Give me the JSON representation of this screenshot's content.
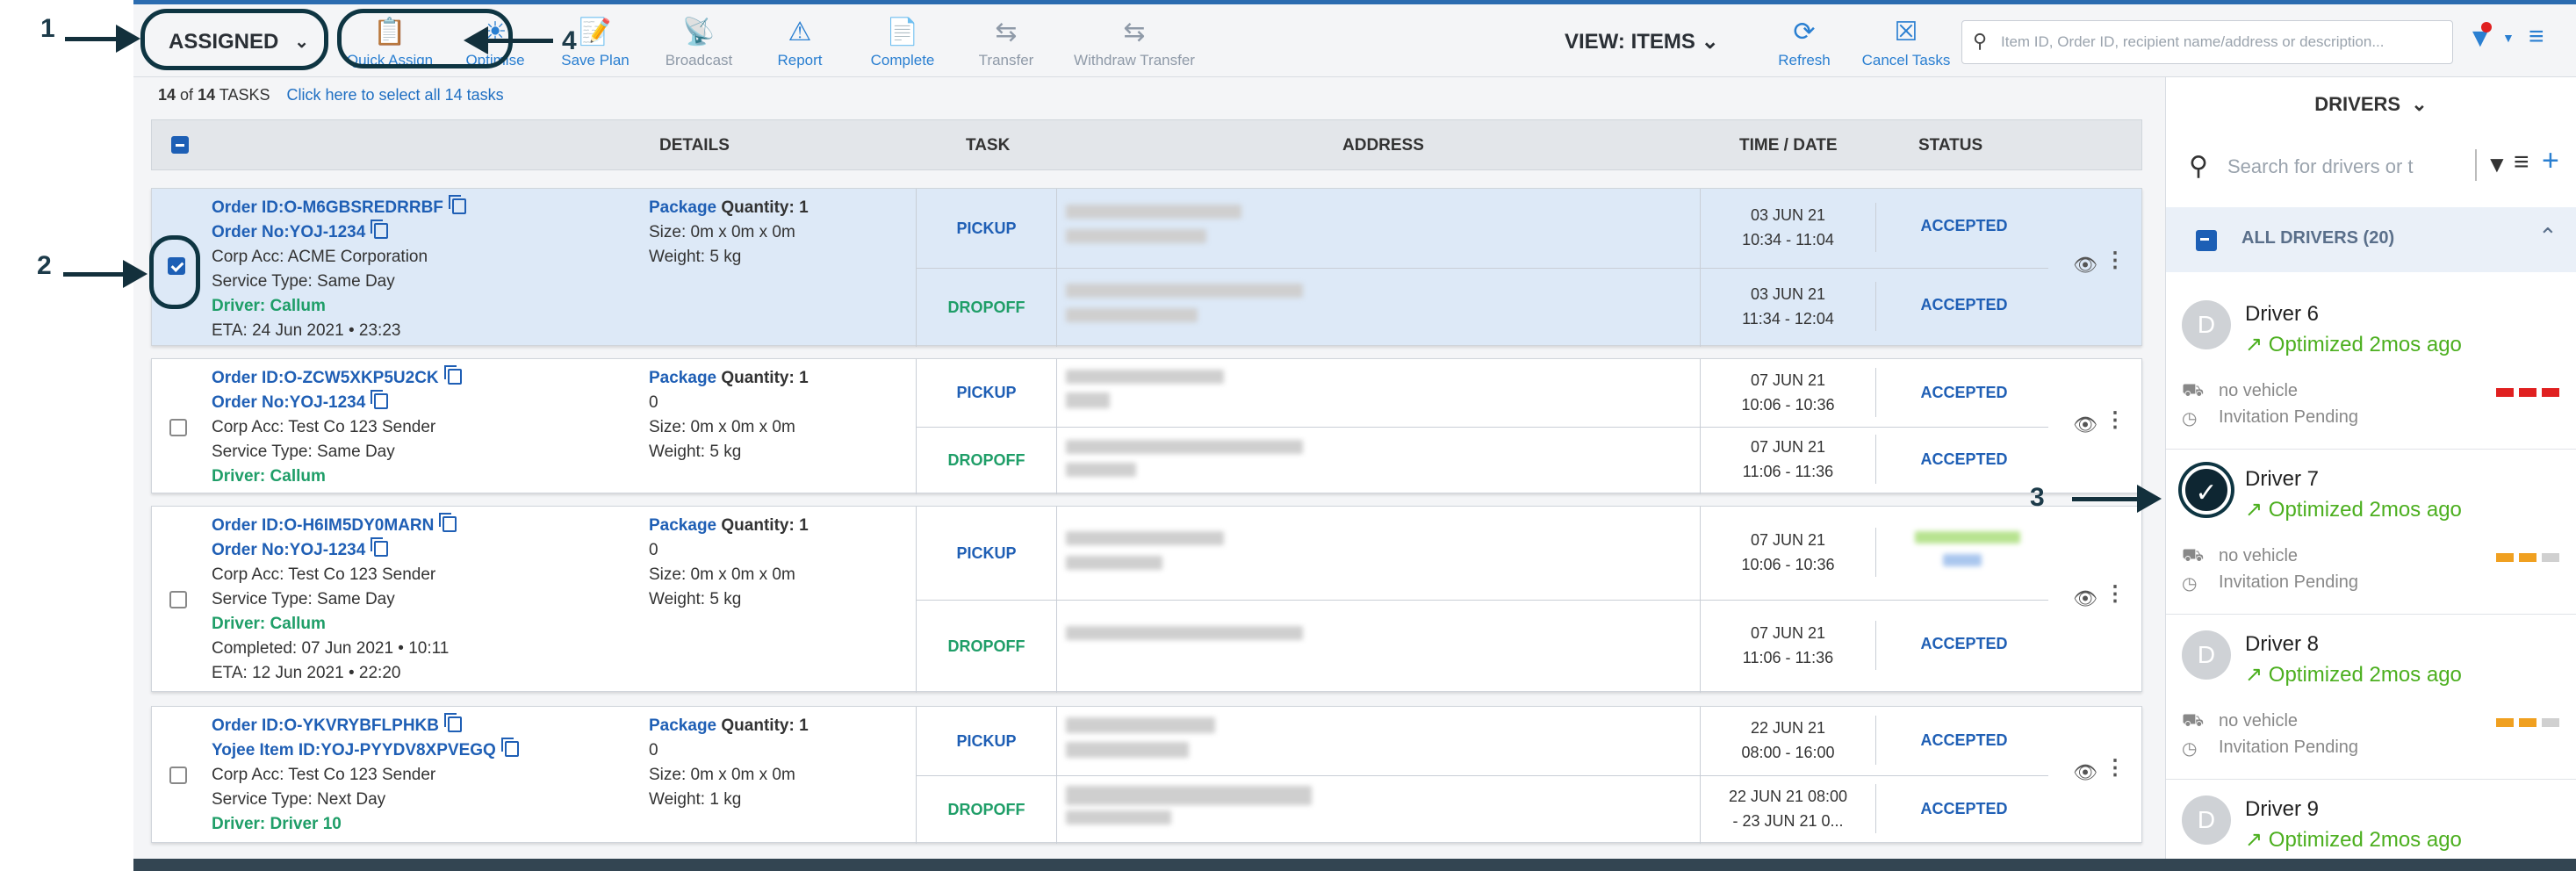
{
  "annotations": [
    "1",
    "2",
    "3",
    "4"
  ],
  "toolbar": {
    "status_value": "ASSIGNED",
    "buttons": [
      {
        "label": "Quick Assign",
        "icon": "clipboard-edit-icon"
      },
      {
        "label": "Optimise",
        "icon": "sun-icon"
      },
      {
        "label": "Save Plan",
        "icon": "save-plan-icon"
      },
      {
        "label": "Broadcast",
        "icon": "broadcast-tower-icon"
      },
      {
        "label": "Report",
        "icon": "warning-triangle-icon"
      },
      {
        "label": "Complete",
        "icon": "complete-doc-icon"
      },
      {
        "label": "Transfer",
        "icon": "swap-arrows-icon"
      },
      {
        "label": "Withdraw Transfer",
        "icon": "swap-arrows-icon"
      }
    ],
    "view_label": "VIEW: ITEMS",
    "refresh_label": "Refresh",
    "cancel_label": "Cancel Tasks",
    "search_placeholder": "Item ID, Order ID, recipient name/address or description..."
  },
  "counts": {
    "shown": "14",
    "of": "of",
    "total": "14",
    "unit": "TASKS",
    "select_all": "Click here to select all 14 tasks"
  },
  "table": {
    "headers": {
      "details": "DETAILS",
      "task": "TASK",
      "address": "ADDRESS",
      "time": "TIME / DATE",
      "status": "STATUS"
    },
    "rows": [
      {
        "order_id": "Order ID:O-M6GBSREDRRBF",
        "order_no": "Order No:YOJ-1234",
        "corp": "Corp Acc: ACME Corporation",
        "service": "Service Type: Same Day",
        "driver": "Driver: Callum",
        "extra1": "ETA: 24 Jun 2021 • 23:23",
        "extra2": "",
        "pkg_label": "Package",
        "qty_label": "Quantity: 1",
        "qty_extra": "",
        "size": "Size: 0m x 0m x 0m",
        "weight": "Weight: 5 kg",
        "pickup": {
          "task": "PICKUP",
          "date": "03 JUN 21",
          "time": "10:34 - 11:04",
          "status": "ACCEPTED"
        },
        "dropoff": {
          "task": "DROPOFF",
          "date": "03 JUN 21",
          "time": "11:34 - 12:04",
          "status": "ACCEPTED"
        }
      },
      {
        "order_id": "Order ID:O-ZCW5XKP5U2CK",
        "order_no": "Order No:YOJ-1234",
        "corp": "Corp Acc: Test Co 123 Sender",
        "service": "Service Type: Same Day",
        "driver": "Driver: Callum",
        "extra1": "",
        "extra2": "",
        "pkg_label": "Package",
        "qty_label": "Quantity: 1",
        "qty_extra": "0",
        "size": "Size: 0m x 0m x 0m",
        "weight": "Weight: 5 kg",
        "pickup": {
          "task": "PICKUP",
          "date": "07 JUN 21",
          "time": "10:06 - 10:36",
          "status": "ACCEPTED"
        },
        "dropoff": {
          "task": "DROPOFF",
          "date": "07 JUN 21",
          "time": "11:06 - 11:36",
          "status": "ACCEPTED"
        }
      },
      {
        "order_id": "Order ID:O-H6IM5DY0MARN",
        "order_no": "Order No:YOJ-1234",
        "corp": "Corp Acc: Test Co 123 Sender",
        "service": "Service Type: Same Day",
        "driver": "Driver: Callum",
        "extra1": "Completed: 07 Jun 2021 • 10:11",
        "extra2": "ETA: 12 Jun 2021 • 22:20",
        "pkg_label": "Package",
        "qty_label": "Quantity: 1",
        "qty_extra": "0",
        "size": "Size: 0m x 0m x 0m",
        "weight": "Weight: 5 kg",
        "pickup": {
          "task": "PICKUP",
          "date": "07 JUN 21",
          "time": "10:06 - 10:36",
          "status": ""
        },
        "dropoff": {
          "task": "DROPOFF",
          "date": "07 JUN 21",
          "time": "11:06 - 11:36",
          "status": "ACCEPTED"
        }
      },
      {
        "order_id": "Order ID:O-YKVRYBFLPHKB",
        "order_no": "Yojee Item ID:YOJ-PYYDV8XPVEGQ",
        "corp": "Corp Acc: Test Co 123 Sender",
        "service": "Service Type: Next Day",
        "driver": "Driver: Driver 10",
        "extra1": "",
        "extra2": "",
        "pkg_label": "Package",
        "qty_label": "Quantity: 1",
        "qty_extra": "0",
        "size": "Size: 0m x 0m x 0m",
        "weight": "Weight: 1 kg",
        "pickup": {
          "task": "PICKUP",
          "date": "22 JUN 21",
          "time": "08:00 - 16:00",
          "status": "ACCEPTED"
        },
        "dropoff": {
          "task": "DROPOFF",
          "date": "22 JUN 21 08:00",
          "time": "- 23 JUN 21 0...",
          "status": "ACCEPTED"
        }
      }
    ]
  },
  "drivers": {
    "title": "DRIVERS",
    "search_placeholder": "Search for drivers or t",
    "group_label": "ALL DRIVERS (20)",
    "list": [
      {
        "initial": "D",
        "name": "Driver 6",
        "optimized": "Optimized 2mos ago",
        "vehicle": "no vehicle",
        "invite": "Invitation Pending",
        "bar_color": "#e02020",
        "checked": false
      },
      {
        "initial": "D",
        "name": "Driver 7",
        "optimized": "Optimized 2mos ago",
        "vehicle": "no vehicle",
        "invite": "Invitation Pending",
        "bar_color": "#f0a020",
        "checked": true
      },
      {
        "initial": "D",
        "name": "Driver 8",
        "optimized": "Optimized 2mos ago",
        "vehicle": "no vehicle",
        "invite": "Invitation Pending",
        "bar_color": "#f0a020",
        "checked": false
      },
      {
        "initial": "D",
        "name": "Driver 9",
        "optimized": "Optimized 2mos ago",
        "vehicle": "",
        "invite": "",
        "bar_color": "#f0a020",
        "checked": false
      }
    ]
  }
}
